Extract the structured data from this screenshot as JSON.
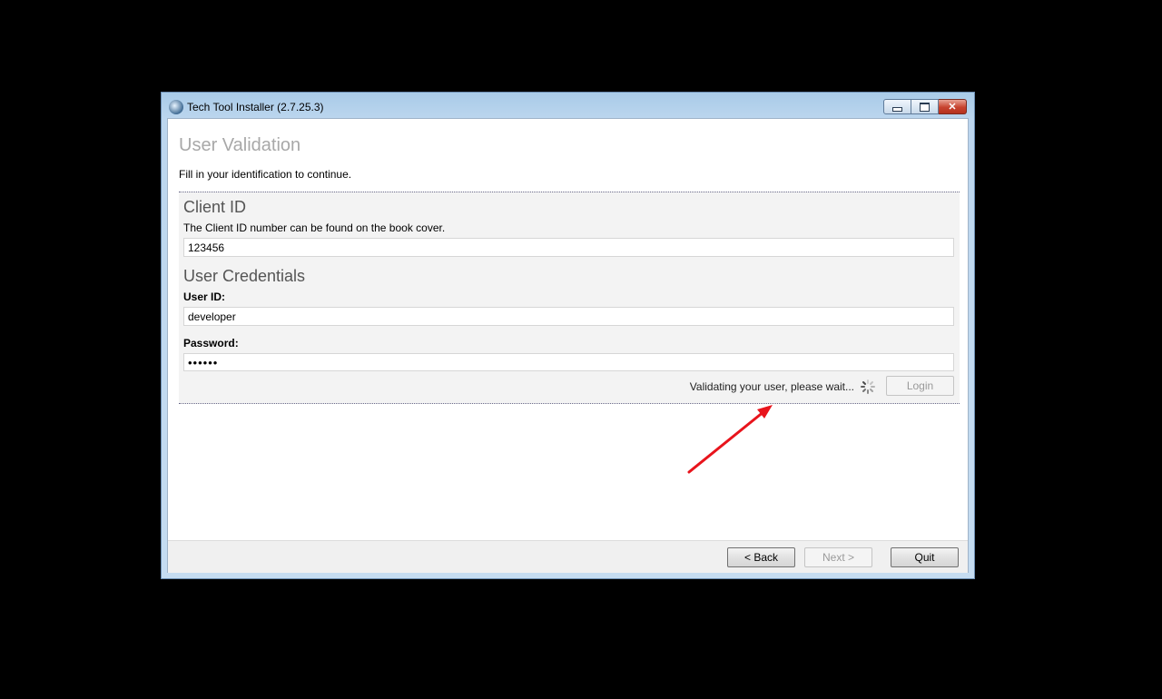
{
  "window": {
    "title": "Tech Tool Installer (2.7.25.3)",
    "controls": {
      "minimize": "",
      "maximize": "",
      "close": "✕"
    }
  },
  "page": {
    "title": "User Validation",
    "description": "Fill in your identification to continue."
  },
  "client_section": {
    "heading": "Client ID",
    "hint": "The Client ID number can be found on the book cover.",
    "client_id_value": "123456"
  },
  "credentials_section": {
    "heading": "User Credentials",
    "user_id_label": "User ID:",
    "user_id_value": "developer",
    "password_label": "Password:",
    "password_value": "••••••"
  },
  "status": {
    "text": "Validating your user, please wait...",
    "login_label": "Login"
  },
  "footer": {
    "back_label": "< Back",
    "next_label": "Next >",
    "quit_label": "Quit"
  },
  "colors": {
    "annotation_arrow": "#e8141c",
    "title_grey": "#a8a8a8",
    "close_red": "#c7432f"
  }
}
